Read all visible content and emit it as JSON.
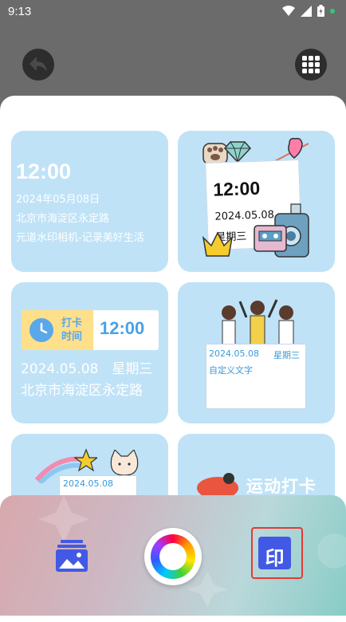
{
  "status_bar": {
    "time": "9:13"
  },
  "cards": [
    {
      "time": "12:00",
      "date": "2024年05月08日",
      "location": "北京市海淀区永定路",
      "slogan": "元道水印相机-记录美好生活"
    },
    {
      "time": "12:00",
      "date": "2024.05.08",
      "weekday": "星期三"
    },
    {
      "punch_label": "打卡时间",
      "time": "12:00",
      "date_weekday": "2024.05.08　星期三",
      "location": "北京市海淀区永定路"
    },
    {
      "date": "2024.05.08",
      "weekday": "星期三",
      "custom_text": "自定义文字"
    },
    {
      "date": "2024.05.08"
    },
    {
      "title": "运动打卡"
    }
  ],
  "toolbar": {
    "stamp_char": "印",
    "icons": [
      "image-icon",
      "color-wheel-icon",
      "stamp-icon"
    ]
  },
  "colors": {
    "card_bg": "#bfe2f7",
    "accent_blue": "#4259e6",
    "highlight_red": "#e53935"
  }
}
